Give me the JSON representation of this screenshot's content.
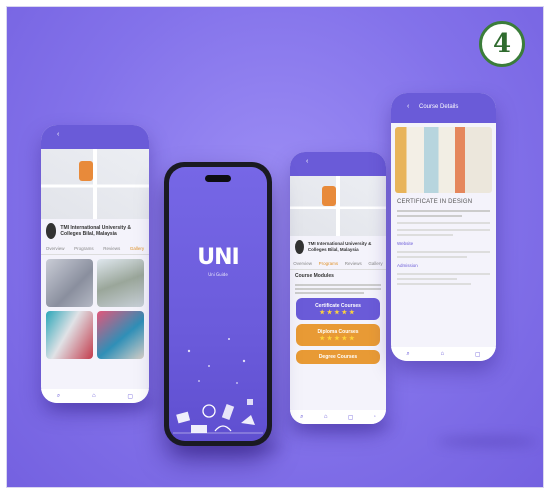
{
  "badge": "4",
  "phone1": {
    "header_icon": "back-arrow-icon",
    "school_name": "TMI International University & Colleges Bilal, Malaysia",
    "tabs": [
      "Overview",
      "Programs",
      "Reviews",
      "Gallery"
    ],
    "active_tab": "Gallery"
  },
  "phone2": {
    "logo": "UNI",
    "tagline": "Uni Guide"
  },
  "phone3": {
    "school_name": "TMI International University & Colleges Bilal, Malaysia",
    "tabs": [
      "Overview",
      "Programs",
      "Reviews",
      "Gallery"
    ],
    "active_tab": "Programs",
    "section_title": "Course Modules",
    "buttons": [
      {
        "label": "Certificate Courses",
        "color": "#6a5bd8"
      },
      {
        "label": "Diploma Courses",
        "color": "#e89a35"
      },
      {
        "label": "Degree Courses",
        "color": "#e89a35"
      }
    ],
    "stars": "★★★★★"
  },
  "phone4": {
    "header_title": "Course Details",
    "course_title": "CERTIFICATE IN DESIGN",
    "section_a": "Website",
    "section_b": "Admission"
  },
  "colors": {
    "primary": "#6a5bd8",
    "accent": "#e89a35",
    "bg": "#8372ea"
  }
}
